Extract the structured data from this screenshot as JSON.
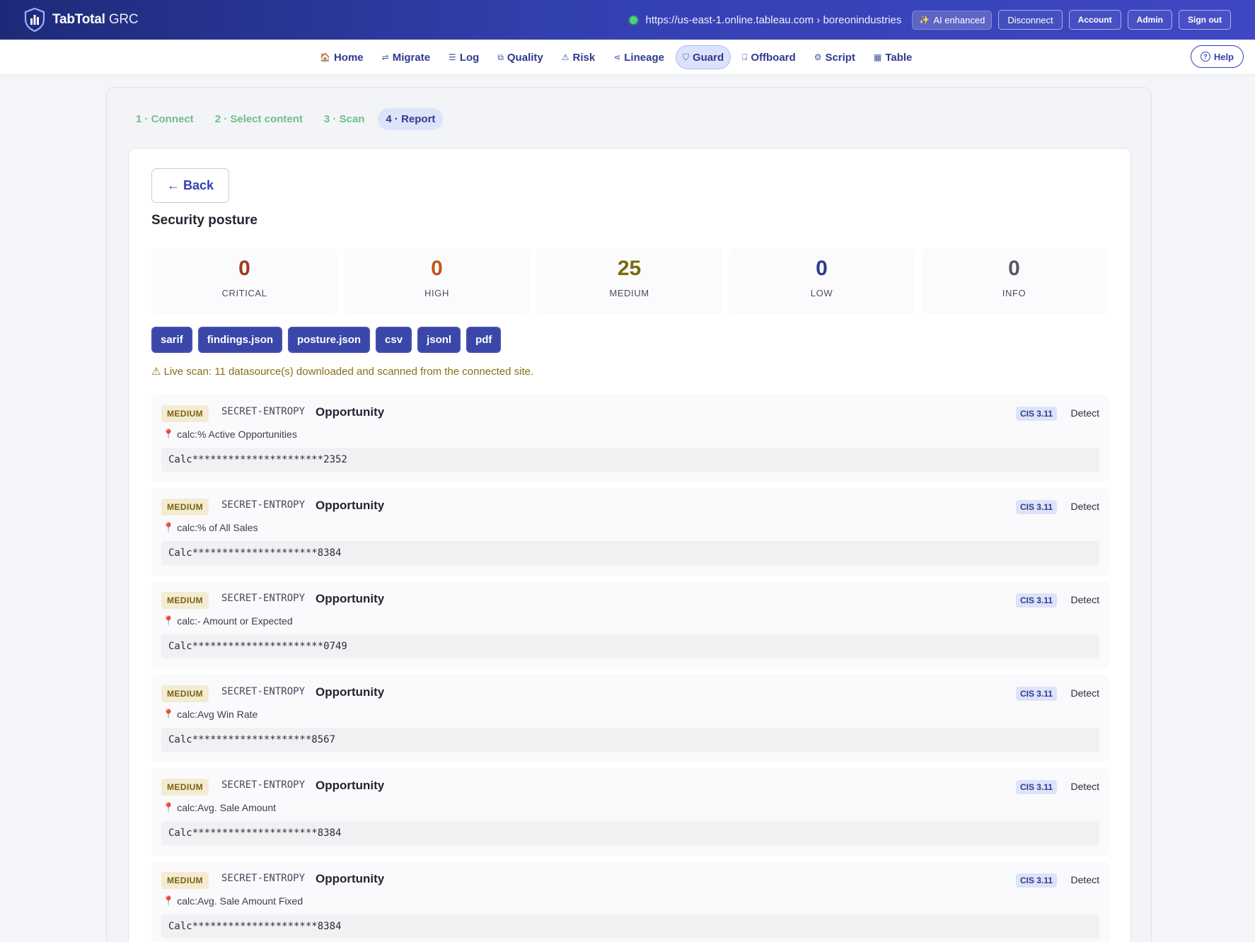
{
  "header": {
    "brand_bold": "TabTotal",
    "brand_thin": " GRC",
    "site_url": "https://us-east-1.online.tableau.com › boreonindustries",
    "ai_label": "AI enhanced",
    "disconnect_label": "Disconnect",
    "account_label": "Account",
    "admin_label": "Admin",
    "signout_label": "Sign out"
  },
  "nav": {
    "items": [
      {
        "label": "Home",
        "icon": "home-icon"
      },
      {
        "label": "Migrate",
        "icon": "migrate-icon"
      },
      {
        "label": "Log",
        "icon": "log-icon"
      },
      {
        "label": "Quality",
        "icon": "quality-icon"
      },
      {
        "label": "Risk",
        "icon": "warning-icon"
      },
      {
        "label": "Lineage",
        "icon": "share-icon"
      },
      {
        "label": "Guard",
        "icon": "shield-icon"
      },
      {
        "label": "Offboard",
        "icon": "offboard-icon"
      },
      {
        "label": "Script",
        "icon": "gear-icon"
      },
      {
        "label": "Table",
        "icon": "table-icon"
      }
    ],
    "active": "Guard",
    "help_label": "Help"
  },
  "steps": [
    {
      "label": "1 · Connect"
    },
    {
      "label": "2 · Select content"
    },
    {
      "label": "3 · Scan"
    },
    {
      "label": "4 · Report"
    }
  ],
  "report": {
    "back_label": "← Back",
    "title": "Security posture",
    "stats": [
      {
        "value": "0",
        "label": "CRITICAL",
        "color": "#a13a1f"
      },
      {
        "value": "0",
        "label": "HIGH",
        "color": "#c1551b"
      },
      {
        "value": "25",
        "label": "MEDIUM",
        "color": "#7a6a10"
      },
      {
        "value": "0",
        "label": "LOW",
        "color": "#2f3a8f"
      },
      {
        "value": "0",
        "label": "INFO",
        "color": "#555a66"
      }
    ],
    "exports": [
      "sarif",
      "findings.json",
      "posture.json",
      "csv",
      "jsonl",
      "pdf"
    ],
    "live_note": "⚠ Live scan: 11 datasource(s) downloaded and scanned from the connected site."
  },
  "findings": [
    {
      "severity": "MEDIUM",
      "rule": "SECRET-ENTROPY",
      "title": "Opportunity",
      "cis": "CIS 3.11",
      "action": "Detect",
      "location": "calc:% Active Opportunities",
      "snippet": "Calc**********************2352"
    },
    {
      "severity": "MEDIUM",
      "rule": "SECRET-ENTROPY",
      "title": "Opportunity",
      "cis": "CIS 3.11",
      "action": "Detect",
      "location": "calc:% of All Sales",
      "snippet": "Calc*********************8384"
    },
    {
      "severity": "MEDIUM",
      "rule": "SECRET-ENTROPY",
      "title": "Opportunity",
      "cis": "CIS 3.11",
      "action": "Detect",
      "location": "calc:- Amount or Expected",
      "snippet": "Calc**********************0749"
    },
    {
      "severity": "MEDIUM",
      "rule": "SECRET-ENTROPY",
      "title": "Opportunity",
      "cis": "CIS 3.11",
      "action": "Detect",
      "location": "calc:Avg Win Rate",
      "snippet": "Calc********************8567"
    },
    {
      "severity": "MEDIUM",
      "rule": "SECRET-ENTROPY",
      "title": "Opportunity",
      "cis": "CIS 3.11",
      "action": "Detect",
      "location": "calc:Avg. Sale Amount",
      "snippet": "Calc*********************8384"
    },
    {
      "severity": "MEDIUM",
      "rule": "SECRET-ENTROPY",
      "title": "Opportunity",
      "cis": "CIS 3.11",
      "action": "Detect",
      "location": "calc:Avg. Sale Amount Fixed",
      "snippet": "Calc*********************8384"
    }
  ]
}
